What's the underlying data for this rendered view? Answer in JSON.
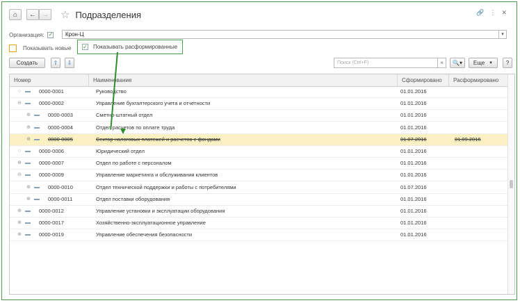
{
  "window": {
    "title": "Подразделения"
  },
  "organization": {
    "label": "Организация:",
    "checked": true,
    "value": "Крон-Ц"
  },
  "filters": {
    "show_new_label": "Показывать новые",
    "show_new_checked": false,
    "show_disbanded_label": "Показывать расформированные",
    "show_disbanded_checked": true
  },
  "toolbar": {
    "create_label": "Создать",
    "search_placeholder": "Поиск (Ctrl+F)",
    "more_label": "Еще",
    "help_label": "?"
  },
  "table": {
    "columns": [
      "Номер",
      "Наименование",
      "Сформировано",
      "Расформировано"
    ],
    "rows": [
      {
        "num": "0000-0001",
        "name": "Руководство",
        "formed": "01.01.2016",
        "disbanded": "",
        "level": 0,
        "tree": "leaf"
      },
      {
        "num": "0000-0002",
        "name": "Управление бухгалтерского учета и отчетности",
        "formed": "01.01.2016",
        "disbanded": "",
        "level": 0,
        "tree": "open"
      },
      {
        "num": "0000-0003",
        "name": "Сметно-штатный отдел",
        "formed": "01.01.2016",
        "disbanded": "",
        "level": 1,
        "tree": "closed"
      },
      {
        "num": "0000-0004",
        "name": "Отдел расчетов по оплате труда",
        "formed": "01.01.2016",
        "disbanded": "",
        "level": 1,
        "tree": "closed"
      },
      {
        "num": "0000-0005",
        "name": "Сектор налоговых платежей и расчетов с фондами",
        "formed": "01.07.2016",
        "disbanded": "01.09.2016",
        "level": 1,
        "tree": "closed",
        "selected": true
      },
      {
        "num": "0000-0006",
        "name": "Юридический отдел",
        "formed": "01.01.2016",
        "disbanded": "",
        "level": 0,
        "tree": "leaf"
      },
      {
        "num": "0000-0007",
        "name": "Отдел по работе с персоналом",
        "formed": "01.01.2016",
        "disbanded": "",
        "level": 0,
        "tree": "closed"
      },
      {
        "num": "0000-0009",
        "name": "Управление маркетинга и обслуживания клиентов",
        "formed": "01.01.2016",
        "disbanded": "",
        "level": 0,
        "tree": "open"
      },
      {
        "num": "0000-0010",
        "name": "Отдел технической поддержки и работы с потребителями",
        "formed": "01.07.2016",
        "disbanded": "",
        "level": 1,
        "tree": "closed"
      },
      {
        "num": "0000-0011",
        "name": "Отдел поставки оборудования",
        "formed": "01.01.2016",
        "disbanded": "",
        "level": 1,
        "tree": "closed"
      },
      {
        "num": "0000-0012",
        "name": "Управление установки и эксплуатации оборудования",
        "formed": "01.01.2016",
        "disbanded": "",
        "level": 0,
        "tree": "closed"
      },
      {
        "num": "0000-0017",
        "name": "Хозяйственно-эксплуатационное управление",
        "formed": "01.01.2016",
        "disbanded": "",
        "level": 0,
        "tree": "closed"
      },
      {
        "num": "0000-0019",
        "name": "Управление обеспечения безопасности",
        "formed": "01.01.2016",
        "disbanded": "",
        "level": 0,
        "tree": "closed"
      }
    ]
  }
}
